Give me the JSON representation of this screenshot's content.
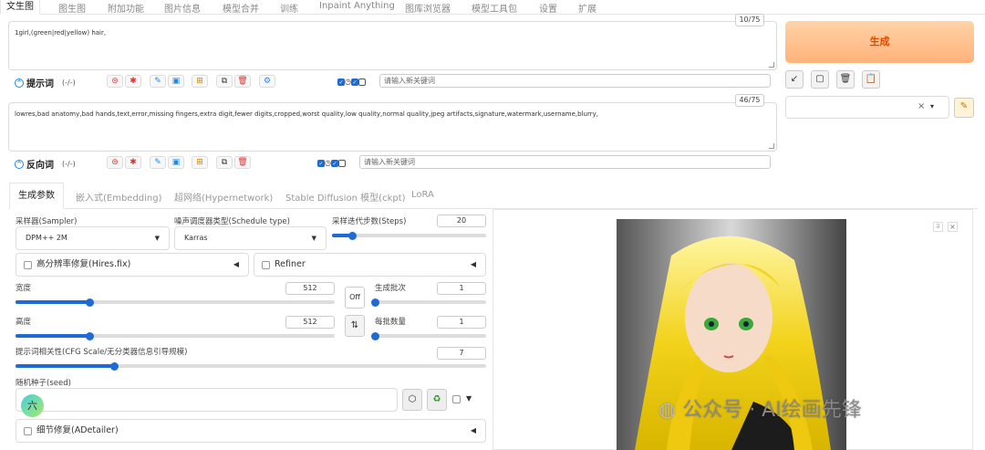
{
  "tabs": [
    "文生图",
    "图生图",
    "附加功能",
    "图片信息",
    "模型合并",
    "训练",
    "Inpaint Anything",
    "图库浏览器",
    "模型工具包",
    "设置",
    "扩展"
  ],
  "prompt": {
    "text": "1girl,(green|red|yellow) hair,",
    "counter": "10/75",
    "label": "提示词",
    "sub": "(-/-)",
    "kw_placeholder": "请输入新关键词"
  },
  "negative": {
    "text": "lowres,bad anatomy,bad hands,text,error,missing fingers,extra digit,fewer digits,cropped,worst quality,low quality,normal quality,jpeg artifacts,signature,watermark,username,blurry,",
    "counter": "46/75",
    "label": "反向词",
    "sub": "(-/-)",
    "kw_placeholder": "请输入新关键词"
  },
  "generate_label": "生成",
  "style_select": {
    "clear": "×",
    "arrow": "▾"
  },
  "settings_tabs": [
    "生成参数",
    "嵌入式(Embedding)",
    "超网络(Hypernetwork)",
    "Stable Diffusion 模型(ckpt)",
    "LoRA"
  ],
  "sampler": {
    "label": "采样器(Sampler)",
    "value": "DPM++ 2M"
  },
  "schedule": {
    "label": "噪声调度器类型(Schedule type)",
    "value": "Karras"
  },
  "steps": {
    "label": "采样迭代步数(Steps)",
    "value": "20",
    "fraction": 0.13
  },
  "hires": {
    "label": "高分辨率修复(Hires.fix)"
  },
  "refiner": {
    "label": "Refiner"
  },
  "width": {
    "label": "宽度",
    "value": "512",
    "fraction": 0.23
  },
  "height": {
    "label": "高度",
    "value": "512",
    "fraction": 0.23
  },
  "off_label": "Off",
  "swap_icon": "⇅",
  "batch_count": {
    "label": "生成批次",
    "value": "1",
    "fraction": 0.0
  },
  "batch_size": {
    "label": "每批数量",
    "value": "1",
    "fraction": 0.0
  },
  "cfg": {
    "label": "提示词相关性(CFG Scale/无分类器信息引导规模)",
    "value": "7",
    "fraction": 0.21
  },
  "seed": {
    "label": "随机种子(seed)",
    "avatar": "六"
  },
  "adetailer": {
    "label": "细节修复(ADetailer)"
  },
  "watermark": "公众号 · AI绘画先锋",
  "colors": {
    "accent": "#1e6bd6",
    "generate_bg": "#ffc08c",
    "generate_text": "#e04a00"
  }
}
